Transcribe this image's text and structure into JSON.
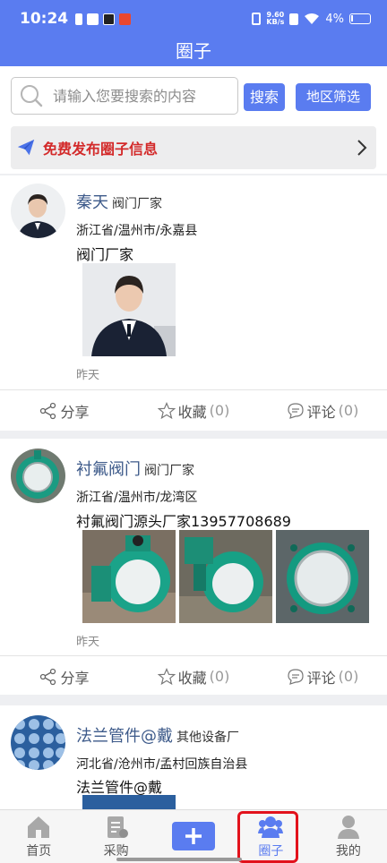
{
  "status": {
    "time": "10:24",
    "net_speed": "9.60",
    "net_unit": "KB/s",
    "battery": "4%"
  },
  "title": "圈子",
  "search": {
    "placeholder": "请输入您要搜索的内容",
    "search_button": "搜索",
    "region_button": "地区筛选"
  },
  "publish": {
    "label": "免费发布圈子信息"
  },
  "actions": {
    "share": "分享",
    "favorite": "收藏",
    "comment": "评论"
  },
  "posts": [
    {
      "name": "秦天",
      "tag": "阀门厂家",
      "location": "浙江省/温州市/永嘉县",
      "text": "阀门厂家",
      "date": "昨天",
      "favorites": "(0)",
      "comments": "(0)"
    },
    {
      "name": "衬氟阀门",
      "tag": "阀门厂家",
      "location": "浙江省/温州市/龙湾区",
      "text": "衬氟阀门源头厂家13957708689",
      "date": "昨天",
      "favorites": "(0)",
      "comments": "(0)"
    },
    {
      "name": "法兰管件@戴",
      "tag": "其他设备厂",
      "location": "河北省/沧州市/孟村回族自治县",
      "text": "法兰管件@戴"
    }
  ],
  "nav": [
    {
      "label": "首页",
      "icon": "home-icon"
    },
    {
      "label": "采购",
      "icon": "purchase-icon"
    },
    {
      "label": "",
      "icon": "plus-icon"
    },
    {
      "label": "圈子",
      "icon": "circle-icon"
    },
    {
      "label": "我的",
      "icon": "user-icon"
    }
  ],
  "colors": {
    "primary": "#5a7cf0",
    "publish_text": "#d32a2a",
    "name_text": "#3d5a8a",
    "highlight": "#e2121c"
  }
}
